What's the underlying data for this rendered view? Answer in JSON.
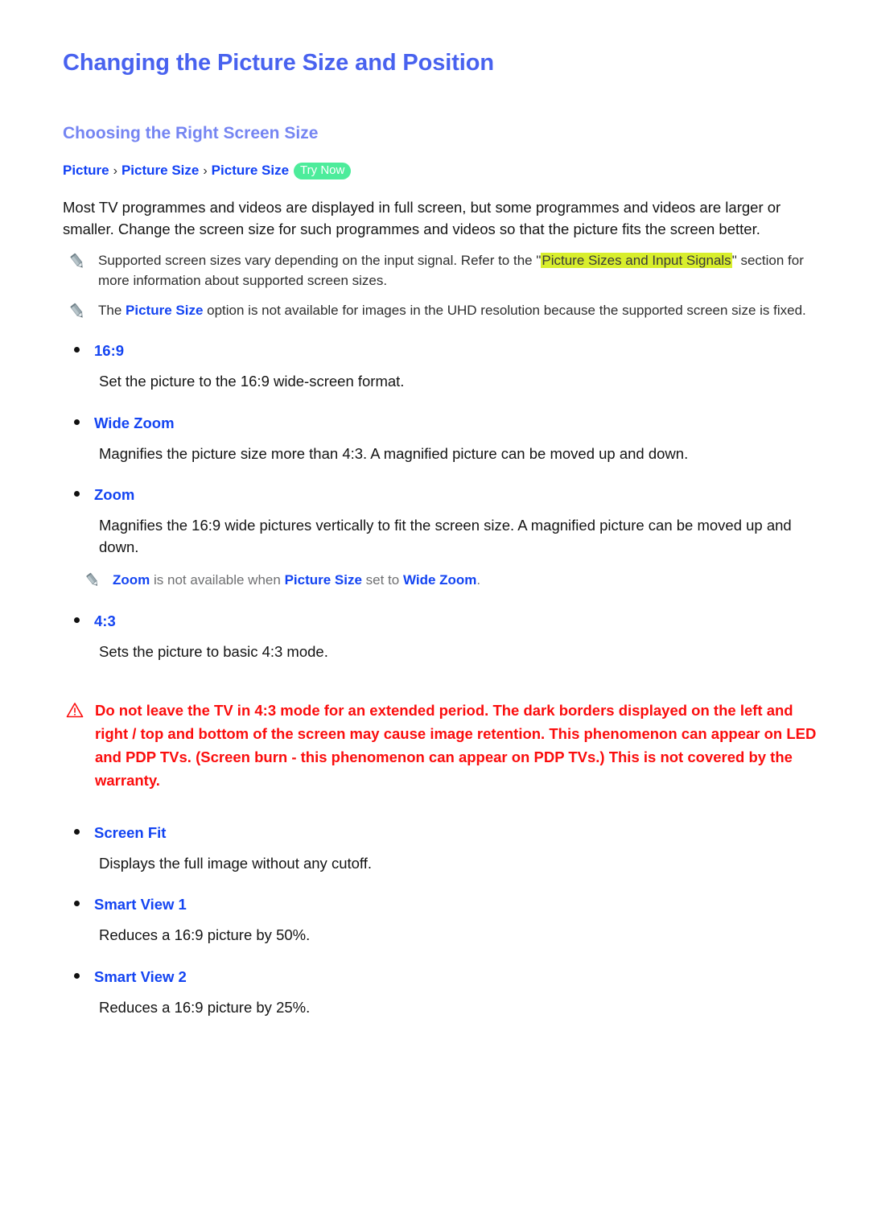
{
  "document": {
    "title": "Changing the Picture Size and Position",
    "section_title": "Choosing the Right Screen Size"
  },
  "breadcrumb": {
    "items": [
      "Picture",
      "Picture Size",
      "Picture Size"
    ],
    "separator": "›",
    "badge": "Try Now"
  },
  "intro": {
    "paragraph": "Most TV programmes and videos are displayed in full screen, but some programmes and videos are larger or smaller. Change the screen size for such programmes and videos so that the picture fits the screen better."
  },
  "notes": [
    {
      "icon": "pencil-icon",
      "prefix": "Supported screen sizes vary depending on the input signal. Refer to the \"",
      "highlight": "Picture Sizes and Input Signals",
      "suffix": "\" section for more information about supported screen sizes."
    },
    {
      "icon": "pencil-icon",
      "prefix": "The ",
      "term": "Picture Size",
      "suffix": " option is not available for images in the UHD resolution because the supported screen size is fixed."
    }
  ],
  "options": [
    {
      "label": "16:9",
      "description": "Set the picture to the 16:9 wide-screen format."
    },
    {
      "label": "Wide Zoom",
      "description": "Magnifies the picture size more than 4:3. A magnified picture can be moved up and down."
    },
    {
      "label": "Zoom",
      "description": "Magnifies the 16:9 wide pictures vertically to fit the screen size. A magnified picture can be moved up and down.",
      "sub_note": {
        "icon": "pencil-icon",
        "term1": "Zoom",
        "mid1": " is not available when ",
        "term2": "Picture Size",
        "mid2": " set to ",
        "term3": "Wide Zoom",
        "end": "."
      }
    },
    {
      "label": "4:3",
      "description": "Sets the picture to basic 4:3 mode."
    },
    {
      "label": "Screen Fit",
      "description": "Displays the full image without any cutoff."
    },
    {
      "label": "Smart View 1",
      "description": "Reduces a 16:9 picture by 50%."
    },
    {
      "label": "Smart View 2",
      "description": "Reduces a 16:9 picture by 25%."
    }
  ],
  "warning": {
    "icon": "warning-triangle-icon",
    "text": "Do not leave the TV in 4:3 mode for an extended period. The dark borders displayed on the left and right / top and bottom of the screen may cause image retention. This phenomenon can appear on LED and PDP TVs. (Screen burn - this phenomenon can appear on PDP TVs.) This is not covered by the warranty."
  },
  "colors": {
    "title_blue": "#4862ef",
    "section_blue": "#7585f2",
    "link_blue": "#1344f2",
    "badge_green": "#4dec9b",
    "highlight_yellow": "#d8ee2c",
    "warning_red": "#fb0d0d",
    "note_grey": "#6f7072"
  }
}
